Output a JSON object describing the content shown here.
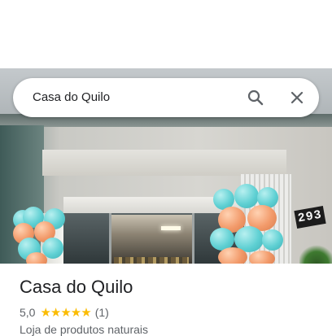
{
  "search": {
    "query": "Casa do Quilo"
  },
  "photo": {
    "house_number": "293"
  },
  "place": {
    "name": "Casa do Quilo",
    "rating": "5,0",
    "stars": "★★★★★",
    "review_count": "(1)",
    "category": "Loja de produtos naturais"
  },
  "colors": {
    "star": "#fbbc04",
    "text_primary": "#202124",
    "text_secondary": "#5f6368",
    "icon": "#5f6368"
  },
  "icons": [
    "search-icon",
    "close-icon"
  ]
}
